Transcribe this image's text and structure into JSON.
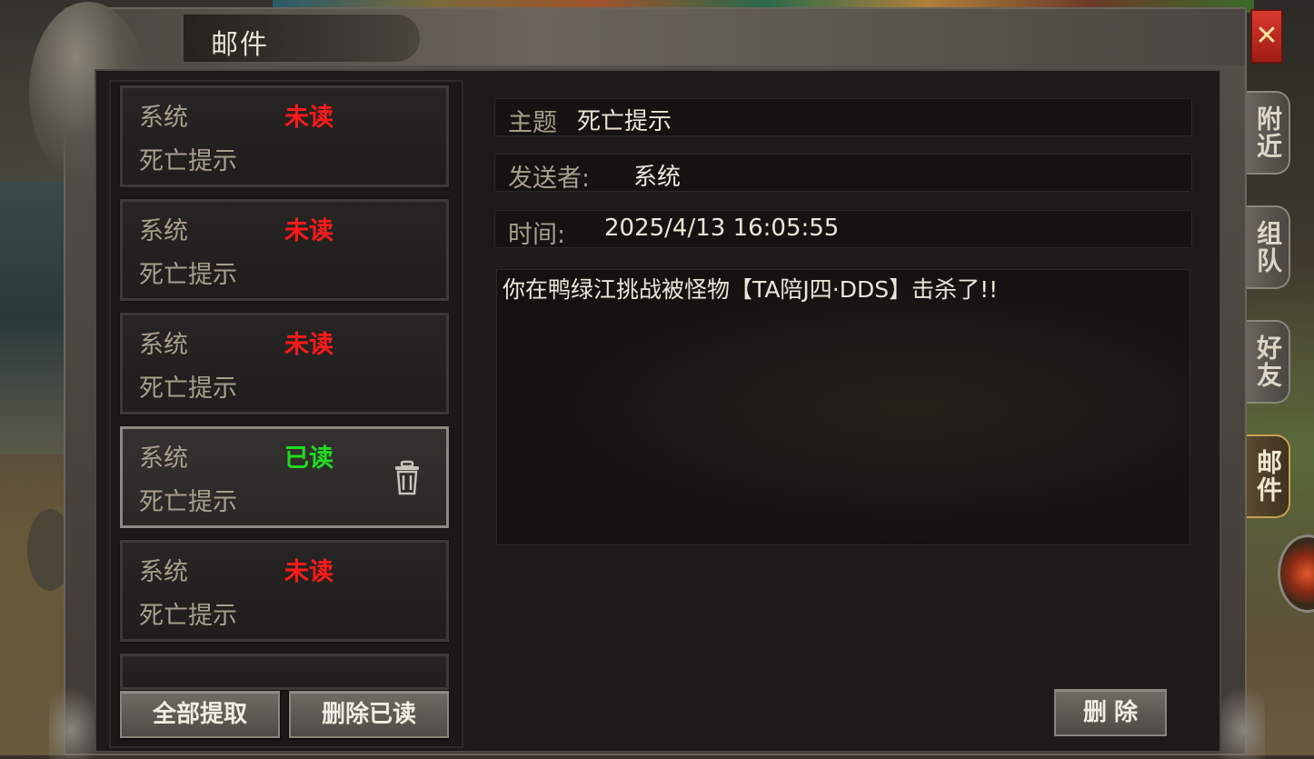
{
  "window": {
    "title": "邮件",
    "close_symbol": "✕"
  },
  "mail_list": [
    {
      "sender": "系统",
      "status": "未读",
      "read": false,
      "subject": "死亡提示"
    },
    {
      "sender": "系统",
      "status": "未读",
      "read": false,
      "subject": "死亡提示"
    },
    {
      "sender": "系统",
      "status": "未读",
      "read": false,
      "subject": "死亡提示"
    },
    {
      "sender": "系统",
      "status": "已读",
      "read": true,
      "subject": "死亡提示",
      "selected": true
    },
    {
      "sender": "系统",
      "status": "未读",
      "read": false,
      "subject": "死亡提示"
    }
  ],
  "list_buttons": {
    "claim_all": "全部提取",
    "delete_read": "删除已读"
  },
  "detail": {
    "subject_label": "主题",
    "subject_value": "死亡提示",
    "sender_label": "发送者:",
    "sender_value": "系统",
    "time_label": "时间:",
    "time_value": "2025/4/13 16:05:55",
    "content": "你在鸭绿江挑战被怪物【TA陪J四·DDS】击杀了!!",
    "delete_button": "删除"
  },
  "side_tabs": [
    {
      "label": "附近",
      "active": false
    },
    {
      "label": "组队",
      "active": false
    },
    {
      "label": "好友",
      "active": false
    },
    {
      "label": "邮件",
      "active": true
    }
  ],
  "colors": {
    "unread": "#ff1a1a",
    "read": "#1fdc1f",
    "label": "#a89f8c",
    "value": "#ece6d8"
  },
  "icons": {
    "trash": "trash-icon",
    "close": "close-icon"
  }
}
